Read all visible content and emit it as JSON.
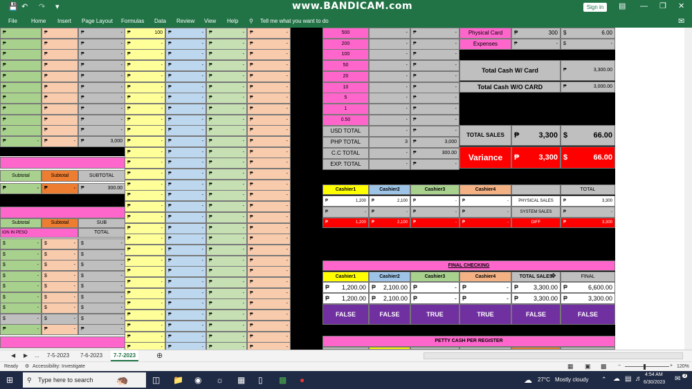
{
  "titlebar": {
    "watermark": "www.BANDICAM.com",
    "signin": "Sign in",
    "icons": [
      "save-icon",
      "undo-icon",
      "redo-icon",
      "customize-icon"
    ]
  },
  "menubar": {
    "items": [
      "File",
      "Home",
      "Insert",
      "Page Layout",
      "Formulas",
      "Data",
      "Review",
      "View",
      "Help"
    ],
    "tell_me": "Tell me what you want to do"
  },
  "sheet": {
    "currency": {
      "peso": "₱",
      "dollar": "$"
    },
    "dash": "-",
    "left": {
      "entry_100": "100",
      "entry_3000": "3,000",
      "entry_300": "300.00",
      "subtotal": "Subtotal",
      "subtotal_caps": "SUBTOTAL",
      "sub": "SUB",
      "total": "TOTAL",
      "ion_in_peso": "ION IN PESO"
    },
    "denoms": [
      "500",
      "200",
      "100",
      "50",
      "20",
      "10",
      "5",
      "1",
      "0.50"
    ],
    "totals_block": [
      {
        "label": "USD TOTAL",
        "mid": "-",
        "right": "-"
      },
      {
        "label": "PHP TOTAL",
        "mid": "3",
        "right": "3,000"
      },
      {
        "label": "C.C TOTAL",
        "mid": "-",
        "right": "300.00"
      },
      {
        "label": "EXP. TOTAL",
        "mid": "-",
        "right": "-"
      }
    ],
    "summary": {
      "physical_card": "Physical Card",
      "physical_card_val": "300",
      "physical_card_usd": "6.00",
      "expenses": "Expenses",
      "total_cash_w_card": "Total Cash W/ Card",
      "total_cash_w_card_val": "3,300.00",
      "total_cash_wo_card": "Total Cash W/O CARD",
      "total_cash_wo_card_val": "3,000.00",
      "total_sales": "TOTAL SALES",
      "total_sales_php": "3,300",
      "total_sales_usd": "66.00",
      "variance": "Variance",
      "variance_php": "3,300",
      "variance_usd": "66.00"
    },
    "cashiers": [
      "Cashier1",
      "Cashier2",
      "Cashier3",
      "Cashier4"
    ],
    "cashier_table": {
      "total": "TOTAL",
      "physical_sales": "PHYSICAL SALES",
      "system_sales": "SYSTEM SALES",
      "diff": "DIFF",
      "row1": [
        "1,200",
        "2,100",
        "-",
        "-",
        "3,300"
      ],
      "row2": [
        "-",
        "-",
        "-",
        "-",
        "-"
      ],
      "row3": [
        "1,200",
        "2,100",
        "-",
        "-",
        "3,300"
      ]
    },
    "final_checking": {
      "title": "FINAL CHECKING",
      "total_sales": "TOTAL SALES",
      "final": "FINAL",
      "row1": [
        "1,200.00",
        "2,100.00",
        "-",
        "-",
        "3,300.00",
        "6,600.00"
      ],
      "row2": [
        "1,200.00",
        "2,100.00",
        "-",
        "-",
        "3,300.00",
        "3,300.00"
      ],
      "flags": [
        "FALSE",
        "FALSE",
        "TRUE",
        "TRUE",
        "FALSE",
        "FALSE"
      ]
    },
    "petty_cash": "PETTY CASH PER REGISTER"
  },
  "tabs": {
    "more": "...",
    "items": [
      "7-5-2023",
      "7-6-2023",
      "7-7-2023"
    ],
    "active": "7-7-2023"
  },
  "statusbar": {
    "ready": "Ready",
    "accessibility": "Accessibility: Investigate",
    "zoom": "120%"
  },
  "taskbar": {
    "search": "Type here to search",
    "weather_temp": "27°C",
    "weather": "Mostly cloudy",
    "time": "4:54 AM",
    "date": "6/30/2023",
    "notif": "3"
  },
  "colors": {
    "excel_green": "#217346",
    "pink": "#ff66cc",
    "yellow": "#ffff00",
    "blue": "#9dc3e6",
    "green": "#c6e0b4",
    "orange": "#f4b183",
    "purple": "#7030a0",
    "red": "#ff0000",
    "gray": "#bfbfbf",
    "lgreen": "#a9d18e",
    "lyellow": "#ffff99",
    "lblue": "#bdd7ee",
    "lorange": "#f8cbad"
  }
}
